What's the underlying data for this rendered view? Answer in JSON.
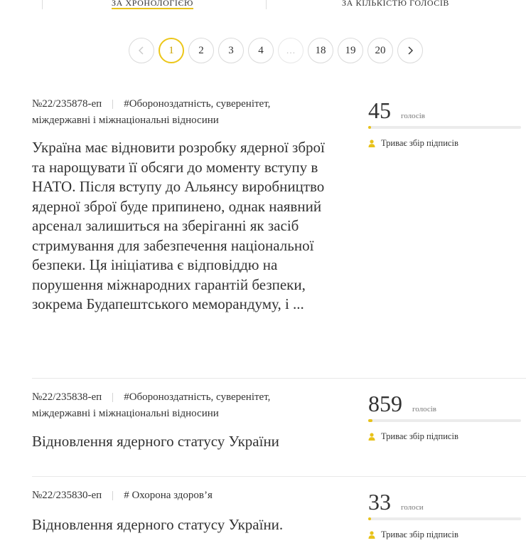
{
  "sort": {
    "chronology_label": "За хронологією",
    "votes_label": "За кількістю голосів"
  },
  "pagination": {
    "prev_icon": "chevron-left-icon",
    "next_icon": "chevron-right-icon",
    "current_page": 1,
    "pages": [
      "1",
      "2",
      "3",
      "4",
      "…",
      "18",
      "19",
      "20"
    ]
  },
  "accent_color": "#e8c21a",
  "petitions": [
    {
      "number": "№22/235878-еп",
      "tags": "#Обороноздатність, суверенітет, міждержавні і міжнаціональні відносини",
      "title": "Україна має відновити розробку ядерної зброї та нарощувати її обсяги до моменту вступу в НАТО. Після вступу до Альянсу виробництво ядерної зброї буде припинено, однак наявний арсенал залишиться на зберіганні як засіб стримування для забезпечення національної безпеки. Ця ініціатива є відповіддю на порушення міжнародних гарантій безпеки, зокрема Будапештського меморандуму, і ...",
      "votes": "45",
      "votes_word": "голосів",
      "progress_percent": 2,
      "status": "Триває збір підписів"
    },
    {
      "number": "№22/235838-еп",
      "tags": "#Обороноздатність, суверенітет, міждержавні і міжнаціональні відносини",
      "title": "Відновлення ядерного статусу України",
      "votes": "859",
      "votes_word": "голосів",
      "progress_percent": 3,
      "status": "Триває збір підписів"
    },
    {
      "number": "№22/235830-еп",
      "tags": "# Охорона здоров’я",
      "title": "Відновлення ядерного статусу України.",
      "votes": "33",
      "votes_word": "голоси",
      "progress_percent": 2,
      "status": "Триває збір підписів"
    }
  ]
}
